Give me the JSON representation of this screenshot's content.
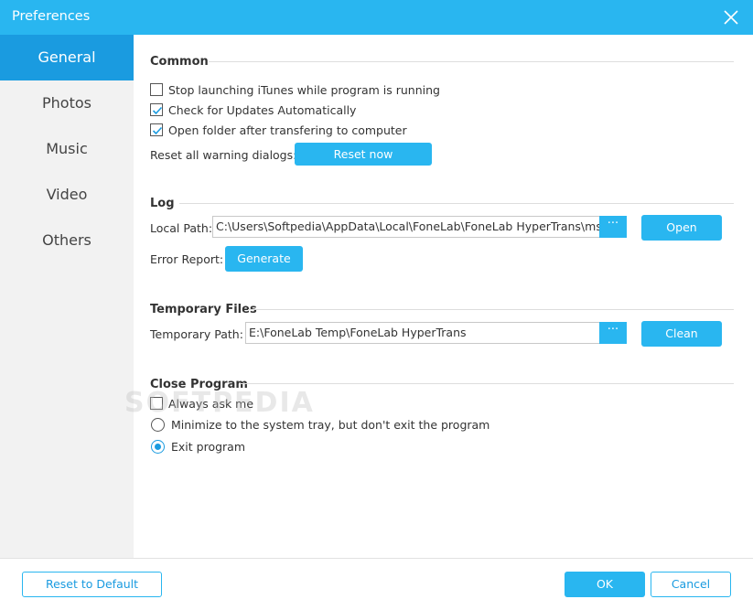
{
  "window": {
    "title": "Preferences"
  },
  "sidebar": {
    "items": [
      {
        "label": "General",
        "active": true
      },
      {
        "label": "Photos",
        "active": false
      },
      {
        "label": "Music",
        "active": false
      },
      {
        "label": "Video",
        "active": false
      },
      {
        "label": "Others",
        "active": false
      }
    ]
  },
  "common": {
    "title": "Common",
    "stop_itunes": {
      "label": "Stop launching iTunes while program is running",
      "checked": false
    },
    "check_updates": {
      "label": "Check for Updates Automatically",
      "checked": true
    },
    "open_folder": {
      "label": "Open folder after transfering to computer",
      "checked": true
    },
    "reset_label": "Reset all warning dialogs:",
    "reset_button": "Reset now"
  },
  "log": {
    "title": "Log",
    "local_path_label": "Local Path:",
    "local_path_value": "C:\\Users\\Softpedia\\AppData\\Local\\FoneLab\\FoneLab HyperTrans\\ms.log",
    "browse_label": "···",
    "open_button": "Open",
    "error_report_label": "Error Report:",
    "generate_button": "Generate"
  },
  "temp": {
    "title": "Temporary Files",
    "path_label": "Temporary Path:",
    "path_value": "E:\\FoneLab Temp\\FoneLab HyperTrans",
    "browse_label": "···",
    "clean_button": "Clean"
  },
  "close_program": {
    "title": "Close Program",
    "always_ask": {
      "label": "Always ask me",
      "checked": false
    },
    "minimize": {
      "label": "Minimize to the system tray, but don't exit the program",
      "selected": false
    },
    "exit": {
      "label": "Exit program",
      "selected": true
    }
  },
  "footer": {
    "reset_default": "Reset to Default",
    "ok": "OK",
    "cancel": "Cancel"
  },
  "watermark": "SOFTPEDIA",
  "colors": {
    "accent": "#29b6f0",
    "active_nav": "#1a9be0",
    "sidebar_bg": "#f2f2f2"
  }
}
